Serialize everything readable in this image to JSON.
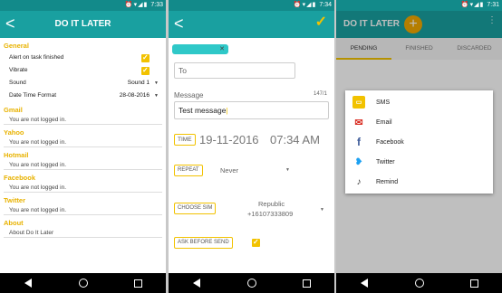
{
  "colors": {
    "accent": "#f2c200",
    "primary": "#19a0a0",
    "primary_dark": "#128a8a"
  },
  "p1": {
    "time": "7:33",
    "title": "DO IT LATER",
    "sections": [
      {
        "label": "General"
      },
      {
        "label": "Gmail",
        "sub": "You are not logged in."
      },
      {
        "label": "Yahoo",
        "sub": "You are not logged in."
      },
      {
        "label": "Hotmail",
        "sub": "You are not logged in."
      },
      {
        "label": "Facebook",
        "sub": "You are not logged in."
      },
      {
        "label": "Twitter",
        "sub": "You are not logged in."
      },
      {
        "label": "About",
        "sub": "About Do It Later"
      }
    ],
    "general": {
      "alert_label": "Alert on task finished",
      "vibrate_label": "Vibrate",
      "sound_label": "Sound",
      "sound_value": "Sound 1",
      "format_label": "Date Time Format",
      "format_value": "28-08-2016"
    }
  },
  "p2": {
    "time": "7:34",
    "to_placeholder": "To",
    "message_label": "Message",
    "message_count": "147/1",
    "message_value": "Test message",
    "time_label": "TIME",
    "date_value": "19-11-2016",
    "time_value": "07:34 AM",
    "repeat_label": "REPEAT",
    "repeat_value": "Never",
    "sim_label": "CHOOSE SIM",
    "sim_value_line1": "Republic",
    "sim_value_line2": "+16107333809",
    "ask_label": "ASK BEFORE SEND"
  },
  "p3": {
    "time": "7:31",
    "title": "DO IT LATER",
    "tabs": [
      "PENDING",
      "FINISHED",
      "DISCARDED"
    ],
    "share_items": [
      {
        "label": "SMS",
        "icon": "sms-icon"
      },
      {
        "label": "Email",
        "icon": "email-icon"
      },
      {
        "label": "Facebook",
        "icon": "facebook-icon"
      },
      {
        "label": "Twitter",
        "icon": "twitter-icon"
      },
      {
        "label": "Remind",
        "icon": "bell-icon"
      }
    ]
  }
}
